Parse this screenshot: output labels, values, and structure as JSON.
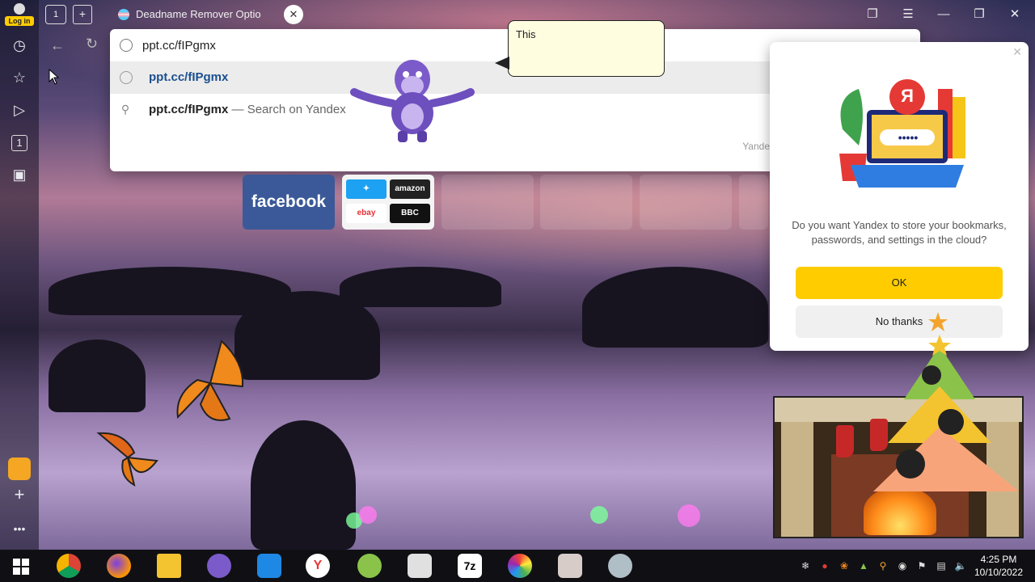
{
  "login": {
    "label": "Log in"
  },
  "tab": {
    "count": "1",
    "title": "Deadname Remover Optio"
  },
  "omnibox": {
    "address": "ppt.cc/fIPgmx",
    "suggestions": [
      {
        "bold": "ppt.cc/fIPgmx",
        "rest": "",
        "icon": "globe-icon"
      },
      {
        "bold": "ppt.cc/fIPgmx",
        "rest": " — Search on Yandex",
        "icon": "search-icon"
      }
    ],
    "hint": "Yande"
  },
  "speech": {
    "text": "This"
  },
  "tiles": {
    "facebook": "facebook",
    "twitter": "",
    "amazon": "amazon",
    "ebay": "ebay",
    "bbc": "BBC"
  },
  "sidebar": {
    "tab_number": "1"
  },
  "popup": {
    "question": "Do you want Yandex to store your bookmarks, passwords, and settings in the cloud?",
    "ok": "OK",
    "no_thanks": "No thanks",
    "logo_letter": "Я",
    "dots": "•••••"
  },
  "tray": {
    "time": "4:25 PM",
    "date": "10/10/2022"
  },
  "colors": {
    "accent": "#ffcc00",
    "facebook": "#3b5998",
    "link": "#1b4f8f"
  }
}
